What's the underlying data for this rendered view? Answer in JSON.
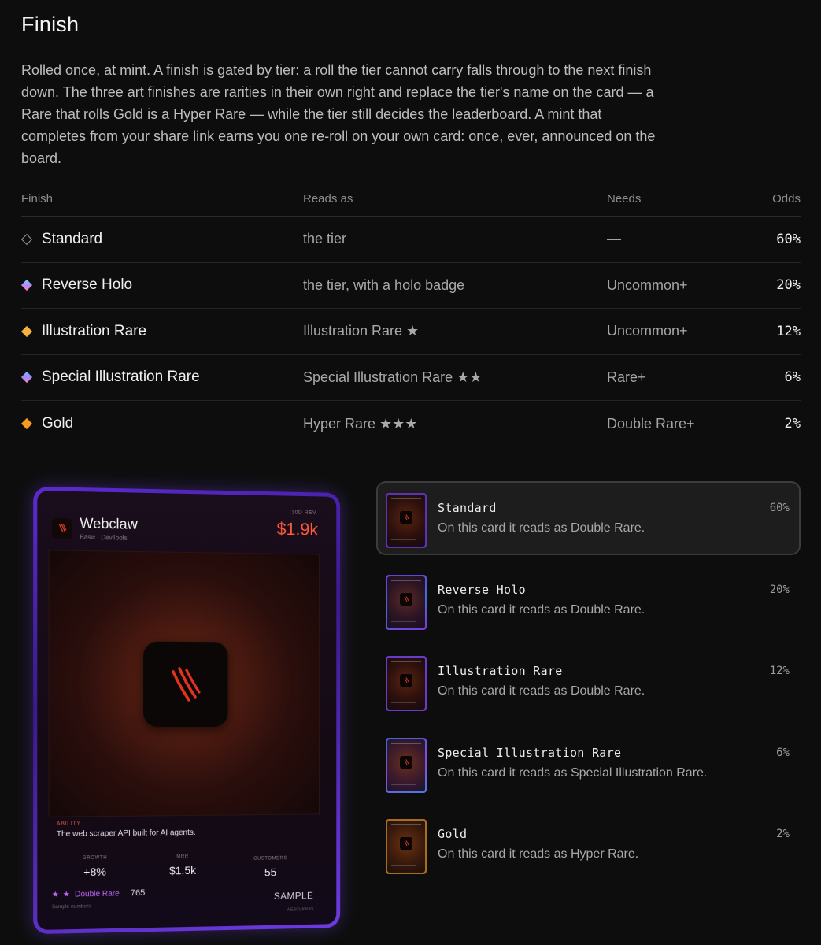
{
  "section": {
    "title": "Finish",
    "description": "Rolled once, at mint. A finish is gated by tier: a roll the tier cannot carry falls through to the next finish down. The three art finishes are rarities in their own right and replace the tier's name on the card — a Rare that rolls Gold is a Hyper Rare — while the tier still decides the leaderboard. A mint that completes from your share link earns you one re-roll on your own card: once, ever, announced on the board."
  },
  "table": {
    "headers": {
      "finish": "Finish",
      "reads_as": "Reads as",
      "needs": "Needs",
      "odds": "Odds"
    },
    "rows": [
      {
        "finish": "Standard",
        "icon": "diamond-outline-icon",
        "reads_as": "the tier",
        "needs": "—",
        "odds": "60%"
      },
      {
        "finish": "Reverse Holo",
        "icon": "diamond-holo-icon",
        "reads_as": "the tier, with a holo badge",
        "needs": "Uncommon+",
        "odds": "20%"
      },
      {
        "finish": "Illustration Rare",
        "icon": "diamond-yellow-icon",
        "reads_as": "Illustration Rare ★",
        "needs": "Uncommon+",
        "odds": "12%"
      },
      {
        "finish": "Special Illustration Rare",
        "icon": "diamond-holo-icon",
        "reads_as": "Special Illustration Rare ★★",
        "needs": "Rare+",
        "odds": "6%"
      },
      {
        "finish": "Gold",
        "icon": "diamond-orange-icon",
        "reads_as": "Hyper Rare ★★★",
        "needs": "Double Rare+",
        "odds": "2%"
      }
    ]
  },
  "card": {
    "name": "Webclaw",
    "category": "Basic · DevTools",
    "rev_label": "30D REV",
    "revenue": "$1.9k",
    "ability_label": "ABILITY",
    "ability_text": "The web scraper API built for AI agents.",
    "stats": {
      "growth": {
        "label": "GROWTH",
        "value": "+8%"
      },
      "mrr": {
        "label": "MRR",
        "value": "$1.5k"
      },
      "customers": {
        "label": "CUSTOMERS",
        "value": "55"
      }
    },
    "rarity_stars": "★ ★",
    "rarity": "Double Rare",
    "serial": "765",
    "sample_note": "Sample numbers",
    "sample_tag": "SAMPLE",
    "code": "WEBCLAW.IO",
    "logo_icon": "claw-icon",
    "colors": {
      "frame": "#5b2bd0",
      "revenue": "#ff5a3a",
      "ability": "#e0513a",
      "rarity": "#c268ff"
    }
  },
  "options": [
    {
      "name": "Standard",
      "desc": "On this card it reads as Double Rare.",
      "odds": "60%",
      "selected": true
    },
    {
      "name": "Reverse Holo",
      "desc": "On this card it reads as Double Rare.",
      "odds": "20%",
      "selected": false
    },
    {
      "name": "Illustration Rare",
      "desc": "On this card it reads as Double Rare.",
      "odds": "12%",
      "selected": false
    },
    {
      "name": "Special Illustration Rare",
      "desc": "On this card it reads as Special Illustration Rare.",
      "odds": "6%",
      "selected": false
    },
    {
      "name": "Gold",
      "desc": "On this card it reads as Hyper Rare.",
      "odds": "2%",
      "selected": false
    }
  ]
}
